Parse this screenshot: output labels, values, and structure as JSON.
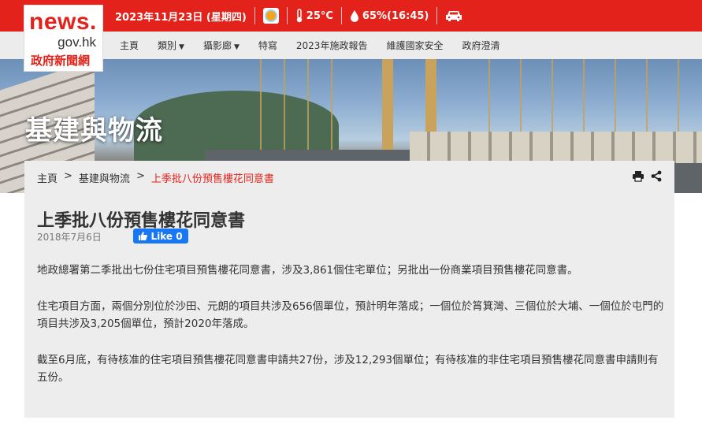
{
  "header": {
    "date": "2023年11月23日 (星期四)",
    "temperature": "25°C",
    "humidity": "65%(16:45)",
    "weather_icon": "sunny-icon",
    "traffic_icon": "car-icon"
  },
  "logo": {
    "line1": "news.",
    "line2": "gov.hk",
    "line3": "政府新聞網"
  },
  "nav": {
    "items": [
      "主頁",
      "類別",
      "攝影廊",
      "特寫",
      "2023年施政報告",
      "維護國家安全",
      "政府澄清"
    ]
  },
  "banner": {
    "title": "基建與物流"
  },
  "breadcrumb": {
    "home": "主頁",
    "sep1": ">",
    "category": "基建與物流",
    "sep2": ">",
    "current": "上季批八份預售樓花同意書"
  },
  "article": {
    "title": "上季批八份預售樓花同意書",
    "date": "2018年7月6日",
    "like_label": "Like 0",
    "paragraphs": [
      "地政總署第二季批出七份住宅項目預售樓花同意書，涉及3,861個住宅單位；另批出一份商業項目預售樓花同意書。",
      "住宅項目方面，兩個分別位於沙田、元朗的項目共涉及656個單位，預計明年落成；一個位於筲箕灣、三個位於大埔、一個位於屯門的項目共涉及3,205個單位，預計2020年落成。",
      "截至6月底，有待核准的住宅項目預售樓花同意書申請共27份，涉及12,293個單位；有待核准的非住宅項目預售樓花同意書申請則有五份。"
    ]
  },
  "colors": {
    "brand_red": "#e3231b",
    "facebook_blue": "#1877f2"
  }
}
